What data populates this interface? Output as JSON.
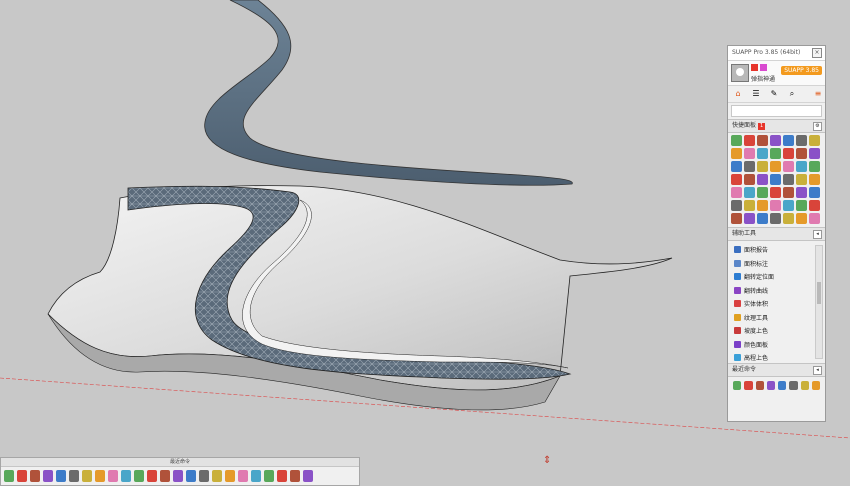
{
  "panel": {
    "title": "SUAPP Pro 3.85 (64bit)",
    "close": "×",
    "user": {
      "name": "弹指神通",
      "login": "SUAPP 3.85"
    },
    "tabs": [
      "⌂",
      "☰",
      "✎",
      "⌕",
      "≡"
    ],
    "section_quick": {
      "label": "快捷面板",
      "count": "1",
      "icon_rows": 7,
      "icon_cols": 7
    },
    "section_tools": {
      "label": "辅助工具",
      "items": [
        "面积报告",
        "面积标注",
        "翻转定位面",
        "翻转曲线",
        "实体体积",
        "纹理工具",
        "坡度上色",
        "颜色面板",
        "高程上色"
      ]
    },
    "section_recent": {
      "label": "最近命令"
    },
    "colors": {
      "accent": "#e7352b",
      "login": "#f39a1e"
    }
  },
  "bottom_toolbar": {
    "title": "最近命令"
  }
}
